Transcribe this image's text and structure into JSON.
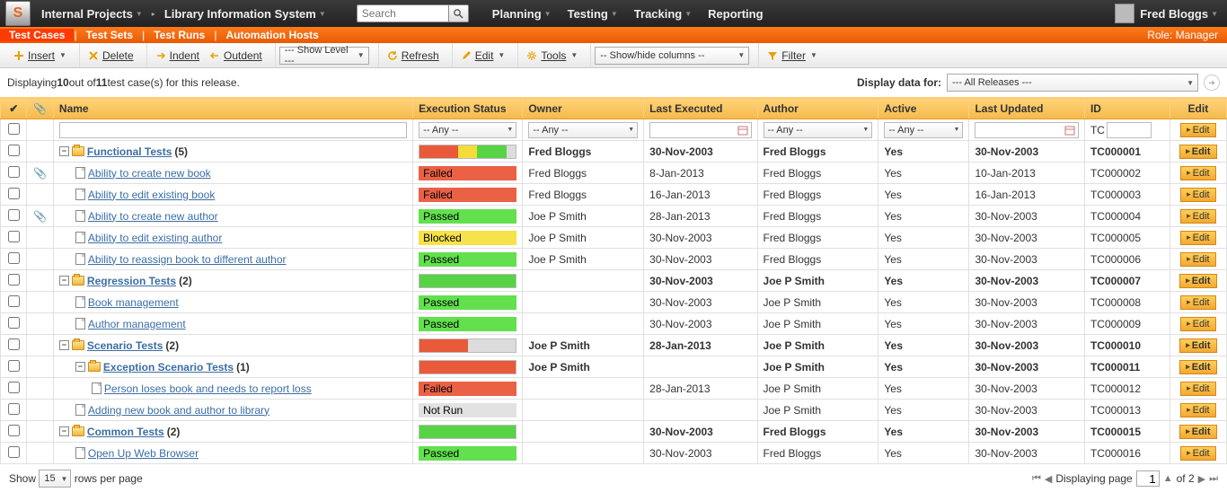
{
  "topnav": {
    "crumb1": "Internal Projects",
    "crumb2": "Library Information System",
    "search_placeholder": "Search",
    "menu": [
      "Planning",
      "Testing",
      "Tracking",
      "Reporting"
    ],
    "user": "Fred Bloggs"
  },
  "subnav": {
    "tabs": [
      "Test Cases",
      "Test Sets",
      "Test Runs",
      "Automation Hosts"
    ],
    "active": 0,
    "role": "Role: Manager"
  },
  "toolbar": {
    "insert": "Insert",
    "delete": "Delete",
    "indent": "Indent",
    "outdent": "Outdent",
    "showlevel": "--- Show Level ---",
    "refresh": "Refresh",
    "edit": "Edit",
    "tools": "Tools",
    "showhide": "-- Show/hide columns --",
    "filter": "Filter"
  },
  "display": {
    "text_pre": "Displaying ",
    "shown": "10",
    "text_mid": " out of ",
    "total": "11",
    "text_post": " test case(s) for this release.",
    "label": "Display data for:",
    "release": "--- All Releases ---"
  },
  "columns": {
    "name": "Name",
    "exec": "Execution Status",
    "owner": "Owner",
    "lastexec": "Last Executed",
    "author": "Author",
    "active": "Active",
    "lastupd": "Last Updated",
    "id": "ID",
    "edit": "Edit"
  },
  "filters": {
    "any": "-- Any --",
    "idprefix": "TC"
  },
  "editLabel": "Edit",
  "rows": [
    {
      "type": "folder",
      "indent": 0,
      "attach": false,
      "name": "Functional Tests",
      "count": "(5)",
      "segs": [
        [
          "failed",
          40
        ],
        [
          "blocked",
          20
        ],
        [
          "passed",
          30
        ],
        [
          "notrun",
          10
        ]
      ],
      "owner": "Fred Bloggs",
      "lastexec": "30-Nov-2003",
      "author": "Fred Bloggs",
      "active": "Yes",
      "lastupd": "30-Nov-2003",
      "id": "TC000001"
    },
    {
      "type": "tc",
      "indent": 1,
      "attach": true,
      "name": "Ability to create new book",
      "status": "Failed",
      "owner": "Fred Bloggs",
      "lastexec": "8-Jan-2013",
      "author": "Fred Bloggs",
      "active": "Yes",
      "lastupd": "10-Jan-2013",
      "id": "TC000002"
    },
    {
      "type": "tc",
      "indent": 1,
      "attach": false,
      "name": "Ability to edit existing book",
      "status": "Failed",
      "owner": "Fred Bloggs",
      "lastexec": "16-Jan-2013",
      "author": "Fred Bloggs",
      "active": "Yes",
      "lastupd": "16-Jan-2013",
      "id": "TC000003"
    },
    {
      "type": "tc",
      "indent": 1,
      "attach": true,
      "name": "Ability to create new author",
      "status": "Passed",
      "owner": "Joe P Smith",
      "lastexec": "28-Jan-2013",
      "author": "Fred Bloggs",
      "active": "Yes",
      "lastupd": "30-Nov-2003",
      "id": "TC000004"
    },
    {
      "type": "tc",
      "indent": 1,
      "attach": false,
      "name": "Ability to edit existing author",
      "status": "Blocked",
      "owner": "Joe P Smith",
      "lastexec": "30-Nov-2003",
      "author": "Fred Bloggs",
      "active": "Yes",
      "lastupd": "30-Nov-2003",
      "id": "TC000005"
    },
    {
      "type": "tc",
      "indent": 1,
      "attach": false,
      "name": "Ability to reassign book to different author",
      "status": "Passed",
      "owner": "Joe P Smith",
      "lastexec": "30-Nov-2003",
      "author": "Fred Bloggs",
      "active": "Yes",
      "lastupd": "30-Nov-2003",
      "id": "TC000006"
    },
    {
      "type": "folder",
      "indent": 0,
      "attach": false,
      "name": "Regression Tests",
      "count": "(2)",
      "segs": [
        [
          "passed",
          100
        ]
      ],
      "owner": "",
      "lastexec": "30-Nov-2003",
      "author": "Joe P Smith",
      "active": "Yes",
      "lastupd": "30-Nov-2003",
      "id": "TC000007"
    },
    {
      "type": "tc",
      "indent": 1,
      "attach": false,
      "name": "Book management",
      "status": "Passed",
      "owner": "",
      "lastexec": "30-Nov-2003",
      "author": "Joe P Smith",
      "active": "Yes",
      "lastupd": "30-Nov-2003",
      "id": "TC000008"
    },
    {
      "type": "tc",
      "indent": 1,
      "attach": false,
      "name": "Author management",
      "status": "Passed",
      "owner": "",
      "lastexec": "30-Nov-2003",
      "author": "Joe P Smith",
      "active": "Yes",
      "lastupd": "30-Nov-2003",
      "id": "TC000009"
    },
    {
      "type": "folder",
      "indent": 0,
      "attach": false,
      "name": "Scenario Tests",
      "count": "(2)",
      "segs": [
        [
          "failed",
          50
        ],
        [
          "notrun",
          50
        ]
      ],
      "owner": "Joe P Smith",
      "lastexec": "28-Jan-2013",
      "author": "Joe P Smith",
      "active": "Yes",
      "lastupd": "30-Nov-2003",
      "id": "TC000010"
    },
    {
      "type": "folder",
      "indent": 1,
      "attach": false,
      "name": "Exception Scenario Tests",
      "count": "(1)",
      "segs": [
        [
          "failed",
          100
        ]
      ],
      "owner": "Joe P Smith",
      "lastexec": "",
      "author": "Joe P Smith",
      "active": "Yes",
      "lastupd": "30-Nov-2003",
      "id": "TC000011"
    },
    {
      "type": "tc",
      "indent": 2,
      "attach": false,
      "name": "Person loses book and needs to report loss",
      "status": "Failed",
      "owner": "",
      "lastexec": "28-Jan-2013",
      "author": "Joe P Smith",
      "active": "Yes",
      "lastupd": "30-Nov-2003",
      "id": "TC000012"
    },
    {
      "type": "tc",
      "indent": 1,
      "attach": false,
      "name": "Adding new book and author to library",
      "status": "NotRun",
      "statusLabel": "Not Run",
      "owner": "",
      "lastexec": "",
      "author": "Joe P Smith",
      "active": "Yes",
      "lastupd": "30-Nov-2003",
      "id": "TC000013"
    },
    {
      "type": "folder",
      "indent": 0,
      "attach": false,
      "name": "Common Tests",
      "count": "(2)",
      "segs": [
        [
          "passed",
          100
        ]
      ],
      "owner": "",
      "lastexec": "30-Nov-2003",
      "author": "Fred Bloggs",
      "active": "Yes",
      "lastupd": "30-Nov-2003",
      "id": "TC000015"
    },
    {
      "type": "tc",
      "indent": 1,
      "attach": false,
      "name": "Open Up Web Browser",
      "status": "Passed",
      "owner": "",
      "lastexec": "30-Nov-2003",
      "author": "Fred Bloggs",
      "active": "Yes",
      "lastupd": "30-Nov-2003",
      "id": "TC000016"
    }
  ],
  "footer": {
    "show": "Show",
    "rowspp": "rows per page",
    "perpage": "15",
    "displaying": "Displaying page",
    "page": "1",
    "of": "of 2"
  }
}
